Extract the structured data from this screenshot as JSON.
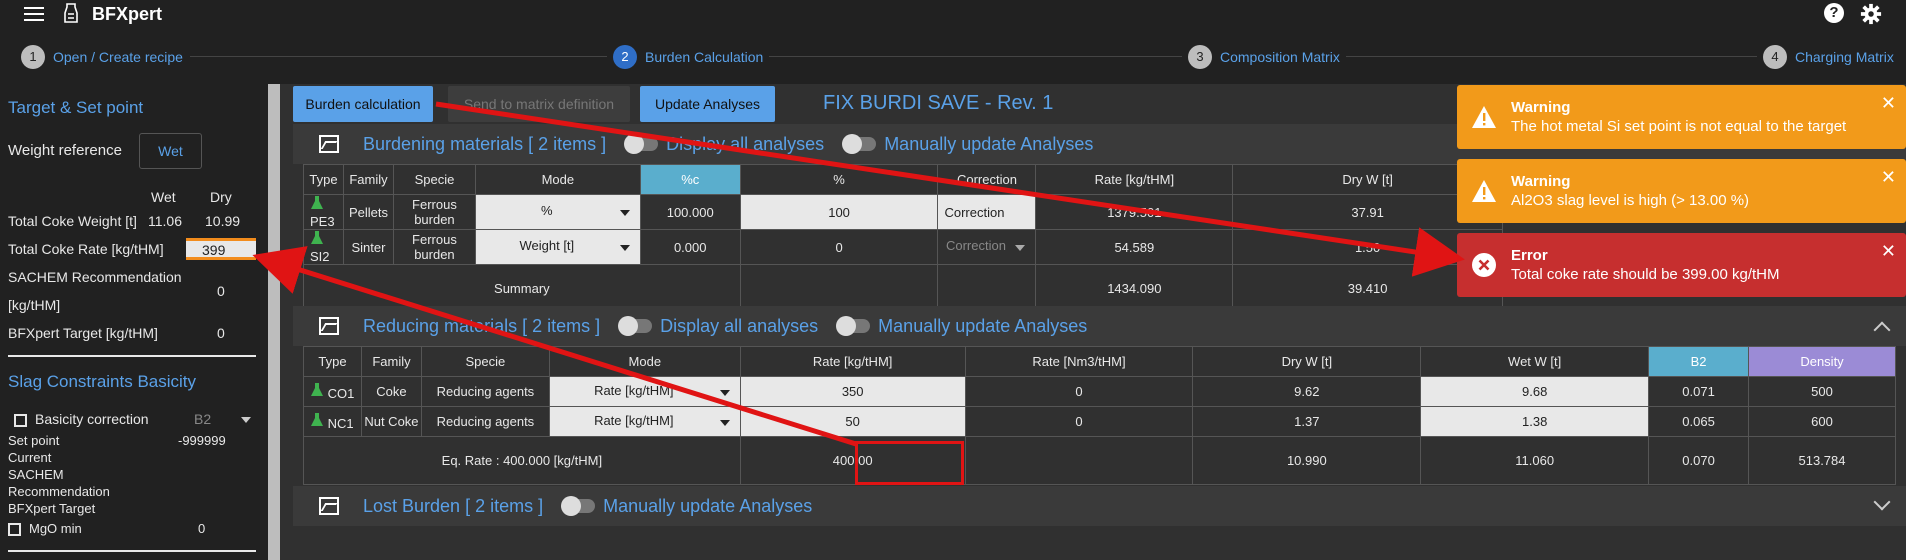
{
  "app": {
    "title": "BFXpert"
  },
  "steps": [
    {
      "num": "1",
      "label": "Open / Create recipe"
    },
    {
      "num": "2",
      "label": "Burden Calculation"
    },
    {
      "num": "3",
      "label": "Composition Matrix"
    },
    {
      "num": "4",
      "label": "Charging Matrix"
    }
  ],
  "sidebar": {
    "title": "Target & Set point",
    "weight_ref_label": "Weight reference",
    "wet_button": "Wet",
    "col_wet": "Wet",
    "col_dry": "Dry",
    "total_coke_weight_label": "Total Coke Weight [t]",
    "total_coke_weight_wet": "11.06",
    "total_coke_weight_dry": "10.99",
    "total_coke_rate_label": "Total Coke Rate [kg/tHM]",
    "total_coke_rate_value": "399",
    "sachem_label_1": "SACHEM Recommendation",
    "sachem_label_2": "[kg/tHM]",
    "sachem_value": "0",
    "bfxpert_target_label": "BFXpert Target [kg/tHM]",
    "bfxpert_target_value": "0",
    "slag_title": "Slag Constraints Basicity",
    "basicity_correction_label": "Basicity correction",
    "basicity_select": "B2",
    "set_point_label": "Set point",
    "set_point_value": "-999999",
    "current_label": "Current",
    "sachem_rec_label": "SACHEM",
    "recommendation_label": "Recommendation",
    "bfx_target_label": "BFXpert Target",
    "mgo_label": "MgO min",
    "mgo_value": "0"
  },
  "toolbar": {
    "burden_calc": "Burden calculation",
    "send_matrix": "Send to matrix definition",
    "update_analyses": "Update Analyses",
    "recipe_title": "FIX BURDI SAVE - Rev. 1"
  },
  "burdening": {
    "title": "Burdening materials [ 2 items ]",
    "toggle1": "Display all analyses",
    "toggle2": "Manually update Analyses",
    "headers": [
      "Type",
      "Family",
      "Specie",
      "Mode",
      "%c",
      "%",
      "Correction",
      "Rate [kg/tHM]",
      "Dry W [t]"
    ],
    "rows": [
      {
        "type": "PE3",
        "family": "Pellets",
        "specie": "Ferrous burden",
        "mode": "%",
        "pc": "100.000",
        "pct": "100",
        "correction": "Correction",
        "rate": "1379.501",
        "dry": "37.91"
      },
      {
        "type": "SI2",
        "family": "Sinter",
        "specie": "Ferrous burden",
        "mode": "Weight [t]",
        "pc": "0.000",
        "pct": "0",
        "correction": "Correction",
        "rate": "54.589",
        "dry": "1.50"
      }
    ],
    "summary_label": "Summary",
    "summary_rate": "1434.090",
    "summary_dry": "39.410"
  },
  "reducing": {
    "title": "Reducing materials [ 2 items ]",
    "toggle1": "Display all analyses",
    "toggle2": "Manually update Analyses",
    "headers": [
      "Type",
      "Family",
      "Specie",
      "Mode",
      "Rate [kg/tHM]",
      "Rate [Nm3/tHM]",
      "Dry W [t]",
      "Wet W [t]",
      "B2",
      "Density"
    ],
    "rows": [
      {
        "type": "CO1",
        "family": "Coke",
        "specie": "Reducing agents",
        "mode": "Rate [kg/tHM]",
        "rate": "350",
        "rate_nm3": "0",
        "dry": "9.62",
        "wet": "9.68",
        "b2": "0.071",
        "density": "500"
      },
      {
        "type": "NC1",
        "family": "Nut Coke",
        "specie": "Reducing agents",
        "mode": "Rate [kg/tHM]",
        "rate": "50",
        "rate_nm3": "0",
        "dry": "1.37",
        "wet": "1.38",
        "b2": "0.065",
        "density": "600"
      }
    ],
    "eq_rate_label": "Eq. Rate : 400.000 [kg/tHM]",
    "eq_rate": "400.00",
    "eq_dry": "10.990",
    "eq_wet": "11.060",
    "eq_b2": "0.070",
    "eq_density": "513.784"
  },
  "lost": {
    "title": "Lost Burden [ 2 items ]",
    "toggle": "Manually update Analyses"
  },
  "toasts": [
    {
      "kind": "warning",
      "title": "Warning",
      "message": "The hot metal Si set point is not equal to the target"
    },
    {
      "kind": "warning",
      "title": "Warning",
      "message": "Al2O3 slag level is high (> 13.00 %)"
    },
    {
      "kind": "error",
      "title": "Error",
      "message": "Total coke rate should be 399.00 kg/tHM"
    }
  ],
  "colors": {
    "accent": "#5aa1e8",
    "warning": "#f29a1a",
    "error": "#c62f2f",
    "annotation": "#e01414"
  }
}
